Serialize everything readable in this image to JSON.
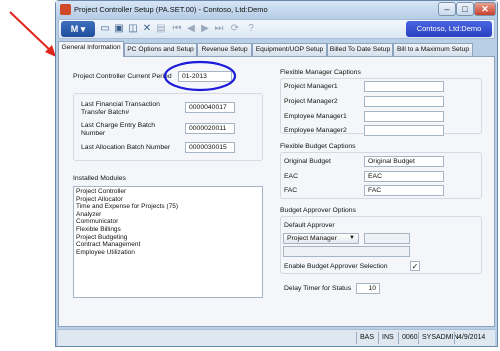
{
  "window": {
    "title": "Project Controller Setup (PA.SET.00) - Contoso, Ltd:Demo",
    "company": "Contoso, Ltd:Demo"
  },
  "toolbar": {
    "menu_label": "M",
    "icons": [
      "new-document-icon",
      "save-icon",
      "save-copy-icon",
      "delete-icon",
      "cancel-icon",
      "first-icon",
      "previous-icon",
      "next-icon",
      "last-icon",
      "refresh-icon",
      "help-icon"
    ]
  },
  "tabs": [
    {
      "label": "General Information",
      "active": true
    },
    {
      "label": "PC Options and Setup",
      "active": false
    },
    {
      "label": "Revenue Setup",
      "active": false
    },
    {
      "label": "Equipment/UOP Setup",
      "active": false
    },
    {
      "label": "Billed To Date Setup",
      "active": false
    },
    {
      "label": "Bill to a Maximum Setup",
      "active": false
    }
  ],
  "general": {
    "current_period_label": "Project Controller Current Period",
    "current_period_value": "01-2013",
    "last_fin_batch_label": "Last Financial Transaction Transfer Batch#",
    "last_fin_batch_value": "0000040017",
    "last_charge_batch_label": "Last Charge Entry Batch Number",
    "last_charge_batch_value": "0000020011",
    "last_alloc_batch_label": "Last Allocation Batch Number",
    "last_alloc_batch_value": "0000030015"
  },
  "installed_modules": {
    "label": "Installed Modules",
    "items": [
      "Project Controller",
      "Project Allocator",
      "Time and Expense for Projects (75)",
      "Analyzer",
      "Communicator",
      "Flexible Billings",
      "Project Budgeting",
      "Contract Management",
      "Employee Utilization"
    ]
  },
  "manager_captions": {
    "label": "Flexible Manager Captions",
    "items": [
      {
        "label": "Project Manager1",
        "value": ""
      },
      {
        "label": "Project Manager2",
        "value": ""
      },
      {
        "label": "Employee Manager1",
        "value": ""
      },
      {
        "label": "Employee Manager2",
        "value": ""
      }
    ]
  },
  "budget_captions": {
    "label": "Flexible Budget Captions",
    "items": [
      {
        "label": "Original Budget",
        "value": "Original Budget"
      },
      {
        "label": "EAC",
        "value": "EAC"
      },
      {
        "label": "FAC",
        "value": "FAC"
      }
    ]
  },
  "budget_approver": {
    "label": "Budget Approver Options",
    "default_label": "Default Approver",
    "default_value": "Project Manager",
    "enable_label": "Enable Budget Approver Selection",
    "enable_checked": true,
    "delay_label": "Delay Timer for Status",
    "delay_value": "10"
  },
  "statusbar": {
    "mode": "BAS",
    "ins": "INS",
    "code": "0060",
    "user": "SYSADMIN",
    "date": "4/9/2014"
  },
  "colors": {
    "annotation_red": "#e0251b",
    "annotation_blue": "#1a1ad8",
    "company_badge": "#2a3fc2"
  }
}
